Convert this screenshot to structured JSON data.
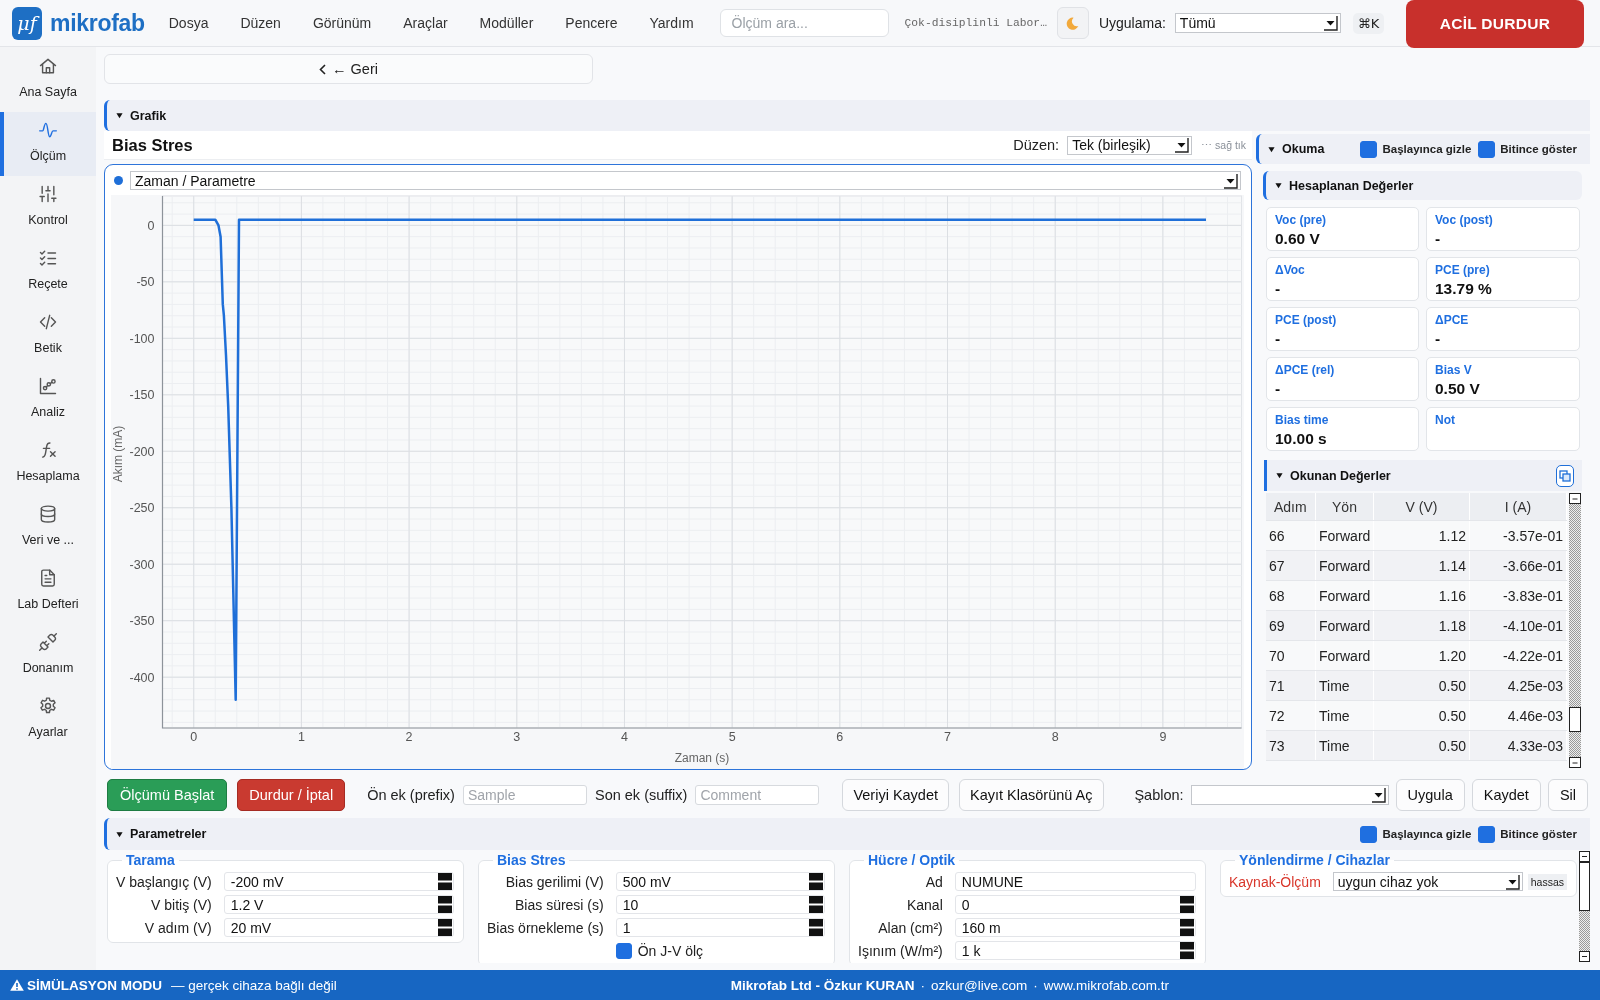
{
  "app": {
    "logo_mark": "μf",
    "logo_text": "mikrofab"
  },
  "menu": [
    "Dosya",
    "Düzen",
    "Görünüm",
    "Araçlar",
    "Modüller",
    "Pencere",
    "Yardım"
  ],
  "search": {
    "placeholder": "Ölçüm ara..."
  },
  "workspace": "Çok-disiplinli Labor…",
  "application": {
    "label": "Uygulama:",
    "value": "Tümü"
  },
  "shortcut": "⌘K",
  "emergency_stop": "ACİL DURDUR",
  "sidebar": {
    "items": [
      {
        "label": "Ana Sayfa",
        "selected": false
      },
      {
        "label": "Ölçüm",
        "selected": true
      },
      {
        "label": "Kontrol",
        "selected": false
      },
      {
        "label": "Reçete",
        "selected": false
      },
      {
        "label": "Betik",
        "selected": false
      },
      {
        "label": "Analiz",
        "selected": false
      },
      {
        "label": "Hesaplama",
        "selected": false
      },
      {
        "label": "Veri ve ...",
        "selected": false
      },
      {
        "label": "Lab Defteri",
        "selected": false
      },
      {
        "label": "Donanım",
        "selected": false
      },
      {
        "label": "Ayarlar",
        "selected": false
      }
    ]
  },
  "back_button": "← Geri",
  "graph_section": {
    "title": "Grafik",
    "expanded": true,
    "plot": {
      "title": "Bias Stres",
      "layout_label": "Düzen:",
      "layout_value": "Tek (birleşik)",
      "hint": "⋯ sağ tık",
      "series_select": "Zaman / Parametre",
      "chart_data": {
        "type": "line",
        "xlabel": "Zaman (s)",
        "ylabel": "Akım (mA)",
        "x": [
          0.0,
          0.2,
          0.23,
          0.25,
          0.27,
          0.28,
          0.3,
          0.32,
          0.35,
          0.39,
          0.42,
          9.4
        ],
        "values": [
          5,
          5,
          0,
          -10,
          -70,
          -80,
          -115,
          -160,
          -250,
          -420,
          5,
          5
        ],
        "xlim": [
          -0.29,
          9.73
        ],
        "ylim": [
          -445,
          26
        ],
        "xticks": [
          0,
          1,
          2,
          3,
          4,
          5,
          6,
          7,
          8,
          9
        ],
        "yticks": [
          0,
          -50,
          -100,
          -150,
          -200,
          -250,
          -300,
          -350,
          -400
        ],
        "grid": true
      }
    }
  },
  "reading_panel": {
    "title": "Okuma",
    "expanded": true,
    "options": [
      {
        "label": "Başlayınca gizle",
        "checked": true
      },
      {
        "label": "Bitince göster",
        "checked": true
      }
    ],
    "computed": {
      "title": "Hesaplanan Değerler",
      "expanded": true,
      "cards": [
        {
          "label": "Voc (pre)",
          "value": "0.60 V"
        },
        {
          "label": "Voc (post)",
          "value": "-"
        },
        {
          "label": "ΔVoc",
          "value": "-"
        },
        {
          "label": "PCE (pre)",
          "value": "13.79 %"
        },
        {
          "label": "PCE (post)",
          "value": "-"
        },
        {
          "label": "ΔPCE",
          "value": "-"
        },
        {
          "label": "ΔPCE (rel)",
          "value": "-"
        },
        {
          "label": "Bias V",
          "value": "0.50 V"
        },
        {
          "label": "Bias time",
          "value": "10.00 s"
        },
        {
          "label": "Not"
        }
      ]
    },
    "readings": {
      "title": "Okunan Değerler",
      "expanded": true,
      "columns": [
        "Adım",
        "Yön",
        "V (V)",
        "I (A)"
      ],
      "rows": [
        [
          "66",
          "Forward",
          "1.12",
          "-3.57e-01"
        ],
        [
          "67",
          "Forward",
          "1.14",
          "-3.66e-01"
        ],
        [
          "68",
          "Forward",
          "1.16",
          "-3.83e-01"
        ],
        [
          "69",
          "Forward",
          "1.18",
          "-4.10e-01"
        ],
        [
          "70",
          "Forward",
          "1.20",
          "-4.22e-01"
        ],
        [
          "71",
          "Time",
          "0.50",
          "4.25e-03"
        ],
        [
          "72",
          "Time",
          "0.50",
          "4.46e-03"
        ],
        [
          "73",
          "Time",
          "0.50",
          "4.33e-03"
        ]
      ]
    }
  },
  "actions": {
    "start": "Ölçümü Başlat",
    "stop": "Durdur / İptal",
    "prefix": {
      "label": "Ön ek (prefix)",
      "placeholder": "Sample"
    },
    "suffix": {
      "label": "Son ek (suffix)",
      "placeholder": "Comment"
    },
    "save": "Veriyi Kaydet",
    "open_folder": "Kayıt Klasörünü Aç",
    "template": {
      "label": "Şablon:"
    },
    "template_buttons": [
      "Uygula",
      "Kaydet",
      "Sil"
    ]
  },
  "parameters": {
    "title": "Parametreler",
    "expanded": true,
    "options": [
      {
        "label": "Başlayınca gizle",
        "checked": true
      },
      {
        "label": "Bitince göster",
        "checked": true
      }
    ],
    "groups": [
      {
        "title": "Tarama",
        "fields": [
          {
            "kind": "number",
            "label": "V başlangıç (V)",
            "value": "-200 mV"
          },
          {
            "kind": "number",
            "label": "V bitiş (V)",
            "value": "1.2 V"
          },
          {
            "kind": "number",
            "label": "V adım (V)",
            "value": "20 mV"
          }
        ]
      },
      {
        "title": "Bias Stres",
        "fields": [
          {
            "kind": "number",
            "label": "Bias gerilimi (V)",
            "value": "500 mV"
          },
          {
            "kind": "number",
            "label": "Bias süresi (s)",
            "value": "10"
          },
          {
            "kind": "number",
            "label": "Bias örnekleme (s)",
            "value": "1"
          },
          {
            "kind": "checkbox",
            "label": "Ön J-V ölç",
            "checked": true
          }
        ]
      },
      {
        "title": "Hücre / Optik",
        "fields": [
          {
            "kind": "text",
            "label": "Ad",
            "value": "NUMUNE"
          },
          {
            "kind": "number",
            "label": "Kanal",
            "value": "0"
          },
          {
            "kind": "number",
            "label": "Alan (cm²)",
            "value": "160 m"
          },
          {
            "kind": "number",
            "label": "Işınım (W/m²)",
            "value": "1 k"
          }
        ]
      },
      {
        "title": "Yönlendirme / Cihazlar",
        "fields": [
          {
            "kind": "select",
            "label": "Kaynak-Ölçüm",
            "value": "uygun cihaz yok",
            "warning": true,
            "tag": "hassas"
          }
        ]
      }
    ]
  },
  "status_bar": {
    "mode": "SİMÜLASYON MODU",
    "note": "— gerçek cihaza bağlı değil",
    "credits": [
      {
        "kind": "name",
        "text": "Mikrofab Ltd - Özkur KURAN"
      },
      {
        "kind": "separator",
        "text": "·"
      },
      {
        "kind": "link",
        "text": "ozkur@live.com"
      },
      {
        "kind": "separator",
        "text": "·"
      },
      {
        "kind": "link",
        "text": "www.mikrofab.com.tr"
      }
    ]
  }
}
